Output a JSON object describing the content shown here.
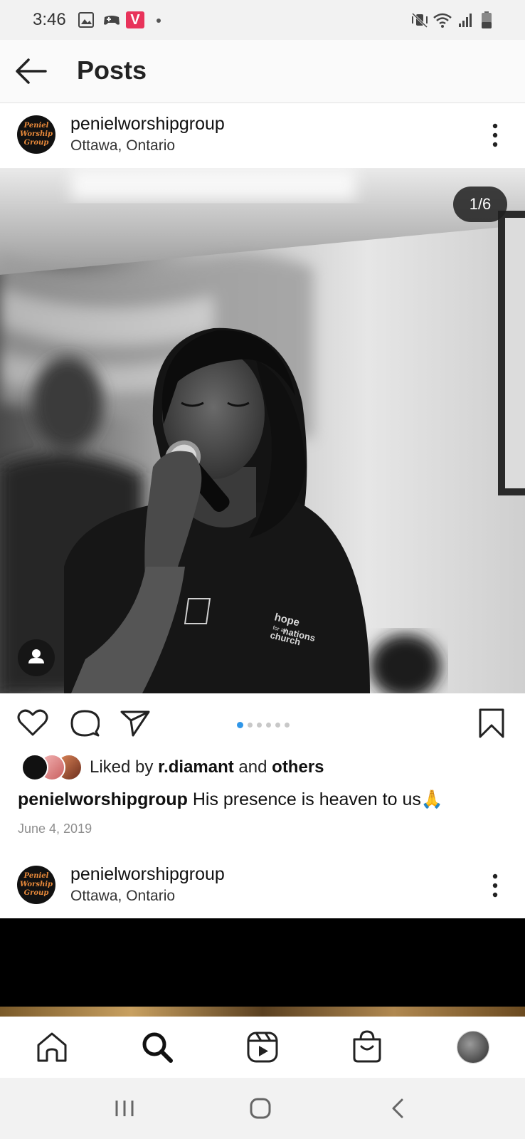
{
  "status_bar": {
    "time": "3:46",
    "left_icons": [
      "image-icon",
      "game-controller-icon",
      "v-app-icon",
      "dot-icon"
    ],
    "right_icons": [
      "mute-vibrate-icon",
      "wifi-icon",
      "signal-icon",
      "battery-icon"
    ],
    "v_app_color": "#e8335a"
  },
  "header": {
    "title": "Posts",
    "back_icon": "back-arrow-icon"
  },
  "post": {
    "avatar_text": [
      "Peniel",
      "Worship",
      "Group"
    ],
    "username": "penielworshipgroup",
    "location": "Ottawa, Ontario",
    "counter": "1/6",
    "carousel_dots": 6,
    "carousel_active": 0,
    "liked_by_prefix": "Liked by ",
    "liked_by_user": "r.diamant",
    "liked_by_join": " and ",
    "liked_by_others": "others",
    "caption_user": "penielworshipgroup",
    "caption_text": " His presence is heaven to us",
    "caption_emoji": "🙏",
    "date": "June 4, 2019",
    "shirt_text": [
      "hope",
      "for all",
      "nations",
      "church"
    ]
  },
  "next_post": {
    "avatar_text": [
      "Peniel",
      "Worship",
      "Group"
    ],
    "username": "penielworshipgroup",
    "location": "Ottawa, Ontario"
  },
  "bottom_nav": {
    "items": [
      "home-icon",
      "search-icon",
      "reels-icon",
      "shop-icon",
      "profile-avatar"
    ]
  },
  "system_nav": {
    "items": [
      "recent-apps-icon",
      "home-button-icon",
      "back-button-icon"
    ]
  },
  "colors": {
    "accent": "#2f96e8",
    "logo_orange": "#e8893a",
    "status_bar_bg": "#f2f2f2"
  }
}
